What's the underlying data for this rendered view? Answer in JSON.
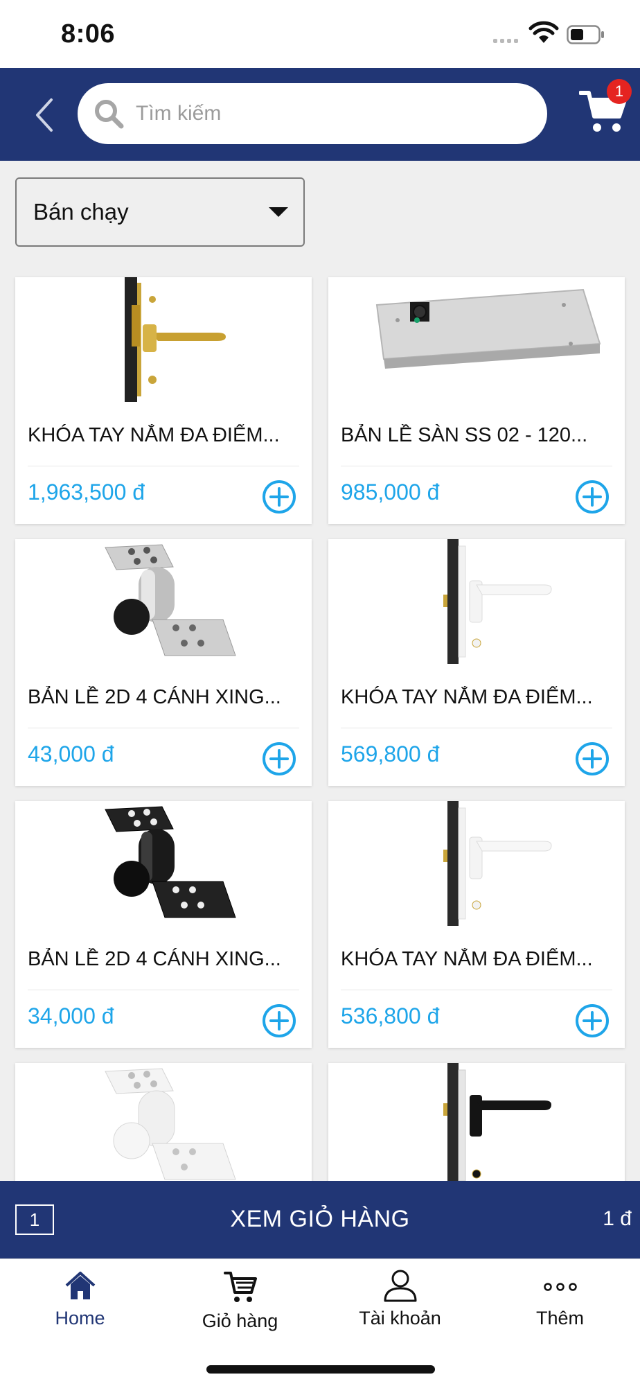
{
  "status_bar": {
    "time": "8:06"
  },
  "header": {
    "search_placeholder": "Tìm kiếm",
    "cart_badge": "1"
  },
  "sort": {
    "selected": "Bán chạy"
  },
  "products": [
    {
      "name": "KHÓA TAY NẮM ĐA ĐIỂM...",
      "price": "1,963,500 đ",
      "image": "gold-lever-lock"
    },
    {
      "name": "BẢN LỀ SÀN SS 02 - 120...",
      "price": "985,000 đ",
      "image": "floor-hinge"
    },
    {
      "name": "BẢN LỀ 2D 4 CÁNH XING...",
      "price": "43,000 đ",
      "image": "silver-door-hinge"
    },
    {
      "name": "KHÓA TAY NẮM ĐA ĐIỂM...",
      "price": "569,800 đ",
      "image": "white-lever-lock"
    },
    {
      "name": "BẢN LỀ 2D 4 CÁNH XING...",
      "price": "34,000 đ",
      "image": "black-door-hinge"
    },
    {
      "name": "KHÓA TAY NẮM ĐA ĐIỂM...",
      "price": "536,800 đ",
      "image": "white-lever-lock"
    },
    {
      "image": "white-door-hinge"
    },
    {
      "image": "black-lever-lock"
    }
  ],
  "cart_bar": {
    "quantity": "1",
    "label": "XEM GIỎ HÀNG",
    "total": "1 đ"
  },
  "tabs": [
    {
      "label": "Home",
      "icon": "home-icon"
    },
    {
      "label": "Giỏ hàng",
      "icon": "cart-icon"
    },
    {
      "label": "Tài khoản",
      "icon": "user-icon"
    },
    {
      "label": "Thêm",
      "icon": "more-icon"
    }
  ],
  "colors": {
    "brand": "#213675",
    "price": "#1ea5e9",
    "badge": "#e52421"
  }
}
